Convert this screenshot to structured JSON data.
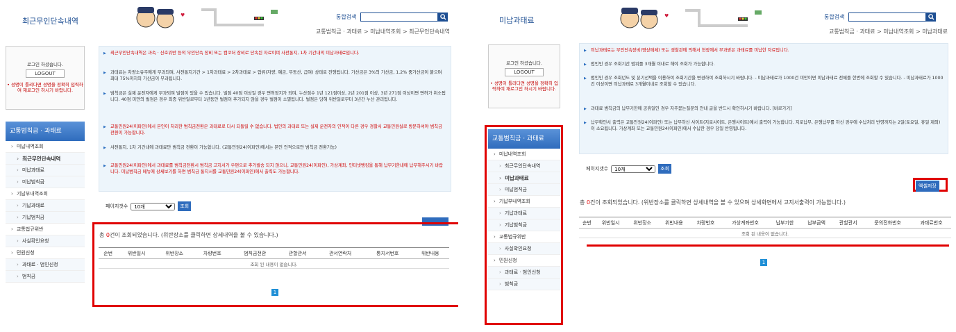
{
  "left": {
    "title": "최근무인단속내역",
    "search": {
      "label": "통합검색",
      "value": ""
    },
    "breadcrumb": "교통범칙금 · 과태료 > 미납내역조회 > 최근무인단속내역",
    "login": {
      "message": "로그인 하셨습니다.",
      "logout": "LOGOUT",
      "warning": "• 성명이 틀리다면 성명을 정확히 입력하여 재로그인 하시기 바랍니다."
    },
    "sidebar": {
      "header": "교통범칙금 · 과태료",
      "items": [
        {
          "label": "미납내역조회",
          "level": "top",
          "active": false
        },
        {
          "label": "최근무인단속내역",
          "level": "sub",
          "active": true
        },
        {
          "label": "미납과태료",
          "level": "sub",
          "active": false
        },
        {
          "label": "미납범칙금",
          "level": "sub",
          "active": false
        },
        {
          "label": "기납부내역조회",
          "level": "top",
          "active": false
        },
        {
          "label": "기납과태료",
          "level": "sub",
          "active": false
        },
        {
          "label": "기납범칙금",
          "level": "sub",
          "active": false
        },
        {
          "label": "교통법규위반",
          "level": "top",
          "active": false
        },
        {
          "label": "사실확인요청",
          "level": "sub",
          "active": false
        },
        {
          "label": "민원신청",
          "level": "top",
          "active": false
        },
        {
          "label": "과태료 · 범인신청",
          "level": "sub",
          "active": false
        },
        {
          "label": "범칙금",
          "level": "sub",
          "active": false
        }
      ]
    },
    "info": [
      {
        "text": "최근무인단속내역은 과속 · 신호위반 등의 무인단속 장비 또는 캠코더 장비로 단속된 자료이며 사전통지, 1차 기간내의 미납과태료입니다.",
        "red": true
      },
      {
        "text": "과태료는 차량소유주에게 부과되며, 사전통지기간 > 1차과태료 > 2차과태료 > 압류(자량, 예금, 부동산, 급여) 상태로 진행됩니다. 가산금은 3%의 가산금, 1.2% 중가산금이 붙으며 최대 75%까지의 가산금이 부과됩니다.",
        "red": false
      },
      {
        "text": "범칙금은 실제 운전자에게 부과되며 벌점이 있을 수 있습니다. 벌점 40점 이상일 경우 면허정지가 되며, 누산점수 1년 121점이상, 2년 201점 이상, 3년 271점 이상이면 면허가 취소됩니다. 40점 미만의 벌점은 경우 최종 위반일로부터 1년동안 벌점이 추가되지 않을 경우 벌점이 소멸됩니다. 벌점은 당해 위반일로부터 3년간 누산 관리됩니다.",
        "red": false
      },
      {
        "text": "교통민원24(이파인)에서 본인이 처리한 범칙금전환은 과태료로 다시 되돌릴 수 없습니다. 법인의 과태료 또는 실제 운전자의 인적이 다른 경우 경찰서 교통민원실로 방문하셔야 범칙금 전환이 가능합니다.",
        "red": true
      },
      {
        "text": "사전통지, 1차 기간내에 과태료만 범칙금 전환이 가능합니다. (교통민원24(이파인)에서는 본인 인적으로만 범칙금 전환가능)",
        "red": false
      },
      {
        "text": "교통민원24(이파인)에서 과태료를 범칙금전환시 범칙금 고지서가 우편으로 추가발송 되지 않으니, 교통민원24(이파인), 가상계좌, 인터넷뱅킹을 통해 납부기한내에 납부해주시기 바랍니다. 미납범칙금 메뉴에 상세보기를 하면 범칙금 통지서를 교통민원24(이파인)에서 출력도 가능합니다.",
        "red": true
      }
    ],
    "page_count_label": "페이지갯수",
    "page_count_value": "10개",
    "query_button": "조회",
    "excel_button": "",
    "total_prefix": "총",
    "total_count": "0",
    "total_suffix": "건이 조회되었습니다. (위반장소를 클릭하면 상세내역을 볼 수 있습니다.)",
    "columns": [
      "순번",
      "위반일시",
      "위반장소",
      "차량번호",
      "범칙금전환",
      "관할관서",
      "관서연락처",
      "통지서번호",
      "위반내용"
    ],
    "empty_message": "조회 된 내용이 없습니다.",
    "page": "1"
  },
  "right": {
    "title": "미납과태료",
    "search": {
      "label": "통합검색",
      "value": ""
    },
    "breadcrumb": "교통범칙금 · 과태료 > 미납내역조회 > 미납과태료",
    "login": {
      "message": "로그인 하셨습니다.",
      "logout": "LOGOUT",
      "warning": "• 성명이 틀리다면 성명을 정확히 입력하여 재로그인 하시기 바랍니다."
    },
    "sidebar": {
      "header": "교통범칙금 · 과태료",
      "items": [
        {
          "label": "미납내역조회",
          "level": "top",
          "active": false
        },
        {
          "label": "최근무인단속내역",
          "level": "sub",
          "active": false
        },
        {
          "label": "미납과태료",
          "level": "sub",
          "active": true
        },
        {
          "label": "미납범칙금",
          "level": "sub",
          "active": false
        },
        {
          "label": "기납부내역조회",
          "level": "top",
          "active": false
        },
        {
          "label": "기납과태료",
          "level": "sub",
          "active": false
        },
        {
          "label": "기납범칙금",
          "level": "sub",
          "active": false
        },
        {
          "label": "교통법규위반",
          "level": "top",
          "active": false
        },
        {
          "label": "사실확인요청",
          "level": "sub",
          "active": false
        },
        {
          "label": "민원신청",
          "level": "top",
          "active": false
        },
        {
          "label": "과태료 · 범인신청",
          "level": "sub",
          "active": false
        },
        {
          "label": "범칙금",
          "level": "sub",
          "active": false
        }
      ]
    },
    "info": [
      {
        "text": "미납과태료는 무인단속장비(영상매체) 또는 경찰관에 의해서 현장에서 부과받은 과태료를 미납한 자료입니다.",
        "red": true
      },
      {
        "text": "법인인 경우 조회기간 범위를 3개월 이내로 해야 조회가 가능합니다.",
        "red": false
      },
      {
        "text": "법인인 경우 조회년도 및 분기선택을 이용하여 조회기간을 변경하여 조회하시기 바랍니다. - 미납과태료가 1000건 미만이면 미납과태료 전체를 한번에 조회할 수 있습니다. - 미납과태료가 1000건 이상이면 미납과태료 3개월이내로 조회할 수 있습니다.",
        "red": false
      },
      {
        "text": "과태료 범칙금의 납부기한에 공휴일인 경우 자주묻는질문의 안내 글을 반드시 확인하시기 바랍니다. [바로가기]",
        "red": false
      },
      {
        "text": "납부확인서 출력은 교통민원24(이파인) 또는 납부하신 사이트(지로사이트, 은행사이트)에서 출력이 가능합니다. 지로납부, 은행납부를 하신 경우에 수납처리 반영까지는 2일(토요일, 휴일 제외)이 소요됩니다. 가상계좌 또는 교통민원24(이파인)에서 수납한 경우 당일 반영됩니다.",
        "red": false
      }
    ],
    "page_count_label": "페이지갯수",
    "page_count_value": "10개",
    "query_button": "조회",
    "excel_button": "엑셀저장",
    "total_prefix": "총",
    "total_count": "0",
    "total_suffix": "건이 조회되었습니다. (위반장소를 클릭하면 상세내역을 볼 수 있으며 상세화면에서 고지서출력이 가능합니다.)",
    "columns": [
      "순번",
      "위반일시",
      "위반장소",
      "위반내용",
      "차량번호",
      "가상계좌번호",
      "납부기한",
      "납부금액",
      "관할관서",
      "문의전화번호",
      "과태료번호"
    ],
    "empty_message": "조회 된 내용이 없습니다.",
    "page": "1"
  },
  "colors": {
    "brand": "#1e4f93",
    "accent": "#2f6cbd",
    "highlight": "#e00000",
    "info_bg": "#edf5fb"
  }
}
